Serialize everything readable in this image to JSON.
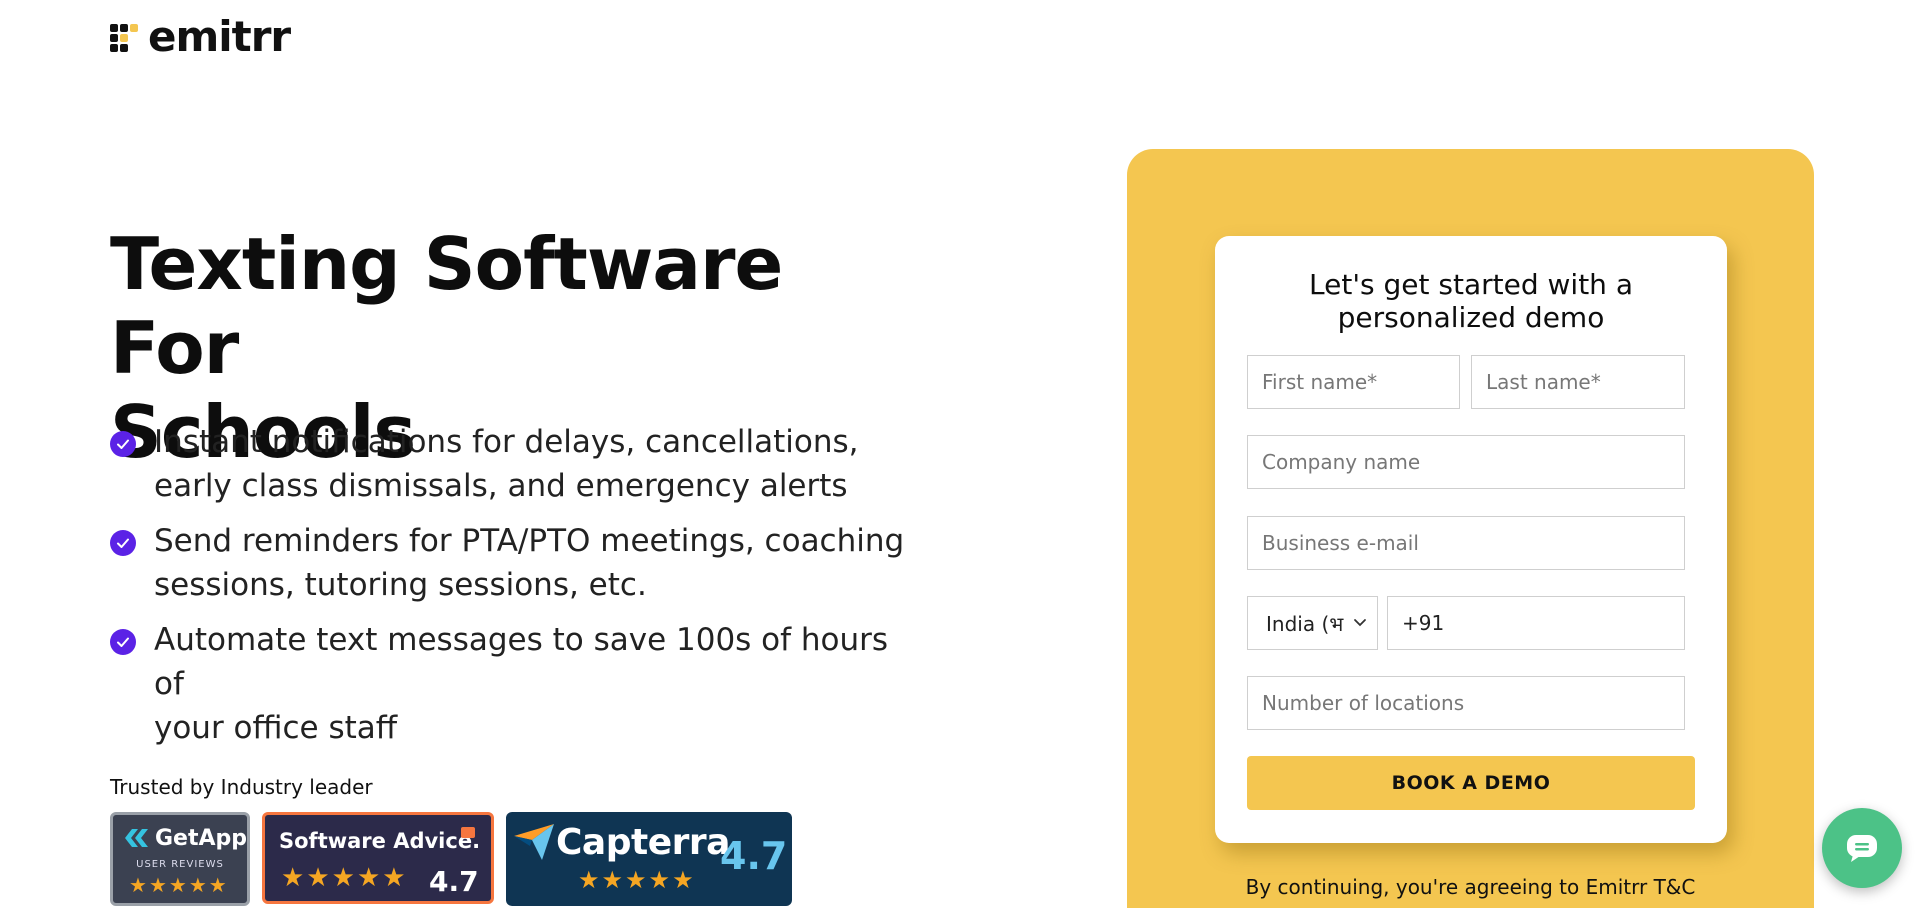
{
  "brand": {
    "name": "emitrr"
  },
  "hero": {
    "title_line1": "Texting Software For",
    "title_line2": "Schools",
    "features": [
      {
        "line1": "Instant notifications for delays, cancellations,",
        "line2": "early class dismissals, and emergency alerts"
      },
      {
        "line1": "Send reminders for PTA/PTO meetings, coaching",
        "line2": "sessions, tutoring sessions, etc."
      },
      {
        "line1": "Automate text messages to save 100s of hours of",
        "line2": "your office staff"
      }
    ]
  },
  "trust": {
    "label": "Trusted by Industry leader",
    "badges": {
      "getapp": {
        "name": "GetApp",
        "sub": "USER REVIEWS",
        "rating": 4.5
      },
      "software_advice": {
        "name": "Software Advice.",
        "score": "4.7",
        "rating": 4.5
      },
      "capterra": {
        "name": "Capterra",
        "score": "4.7",
        "rating": 4.5
      }
    }
  },
  "form": {
    "title_line1": "Let's get started with a",
    "title_line2": "personalized demo",
    "first_name_placeholder": "First name*",
    "last_name_placeholder": "Last name*",
    "company_placeholder": "Company name",
    "email_placeholder": "Business e-mail",
    "country_value": "India (भ",
    "phone_value": "+91",
    "locations_placeholder": "Number of locations",
    "submit_label": "BOOK A DEMO",
    "terms": "By continuing, you're agreeing to Emitrr T&C"
  },
  "colors": {
    "accent_yellow": "#f4c650",
    "check_purple": "#5b22e6",
    "chat_green": "#4cc287"
  },
  "icons": {
    "check": "check-circle-icon",
    "chevron": "chevron-down-icon",
    "chat": "chat-bubble-icon",
    "star": "star-icon"
  }
}
